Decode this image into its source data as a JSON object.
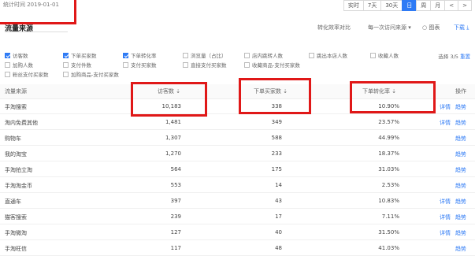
{
  "header": {
    "stat_time": "统计时间 2019-01-01"
  },
  "toolbar": {
    "buttons": [
      "实时",
      "7天",
      "30天",
      "日",
      "周",
      "月",
      "<",
      ">"
    ],
    "active_index": 3
  },
  "section": {
    "title": "流量来源",
    "switch_label": "转化效率对比",
    "period_select": "每一次访问来源",
    "trend_label": "图表",
    "download_label": "下载"
  },
  "metrics": {
    "count_label": "选择 3/5",
    "reset_label": "重置",
    "items": [
      {
        "label": "访客数",
        "checked": true
      },
      {
        "label": "下单买家数",
        "checked": true
      },
      {
        "label": "下单转化率",
        "checked": true
      },
      {
        "label": "浏览量（占比）",
        "checked": false
      },
      {
        "label": "店内跳转人数",
        "checked": false
      },
      {
        "label": "跳出本店人数",
        "checked": false
      },
      {
        "label": "收藏人数",
        "checked": false
      },
      {
        "label": "加购人数",
        "checked": false
      },
      {
        "label": "支付件数",
        "checked": false
      },
      {
        "label": "支付买家数",
        "checked": false
      },
      {
        "label": "直接支付买家数",
        "checked": false
      },
      {
        "label": "收藏商品-支付买家数",
        "checked": false
      },
      {
        "label": "粉丝支付买家数",
        "checked": false
      },
      {
        "label": "加购商品-支付买家数",
        "checked": false
      }
    ]
  },
  "table": {
    "columns": [
      "流量来源",
      "访客数 ⇣",
      "下单买家数 ⇣",
      "下单转化率 ⇣",
      "操作"
    ],
    "rows": [
      {
        "source": "手淘搜索",
        "visitors": "10,183",
        "buyers": "338",
        "rate": "10.90%",
        "actions": [
          "详情",
          "趋势"
        ]
      },
      {
        "source": "淘内免费其他",
        "visitors": "1,481",
        "buyers": "349",
        "rate": "23.57%",
        "actions": [
          "详情",
          "趋势"
        ]
      },
      {
        "source": "购物车",
        "visitors": "1,307",
        "buyers": "588",
        "rate": "44.99%",
        "actions": [
          "趋势"
        ]
      },
      {
        "source": "我的淘宝",
        "visitors": "1,270",
        "buyers": "233",
        "rate": "18.37%",
        "actions": [
          "趋势"
        ]
      },
      {
        "source": "手淘拍立淘",
        "visitors": "564",
        "buyers": "175",
        "rate": "31.03%",
        "actions": [
          "趋势"
        ]
      },
      {
        "source": "手淘淘金币",
        "visitors": "553",
        "buyers": "14",
        "rate": "2.53%",
        "actions": [
          "趋势"
        ]
      },
      {
        "source": "直通车",
        "visitors": "397",
        "buyers": "43",
        "rate": "10.83%",
        "actions": [
          "详情",
          "趋势"
        ]
      },
      {
        "source": "猫客搜索",
        "visitors": "239",
        "buyers": "17",
        "rate": "7.11%",
        "actions": [
          "详情",
          "趋势"
        ]
      },
      {
        "source": "手淘微淘",
        "visitors": "127",
        "buyers": "40",
        "rate": "31.50%",
        "actions": [
          "详情",
          "趋势"
        ]
      },
      {
        "source": "手淘旺信",
        "visitors": "117",
        "buyers": "48",
        "rate": "41.03%",
        "actions": [
          "趋势"
        ]
      }
    ]
  }
}
